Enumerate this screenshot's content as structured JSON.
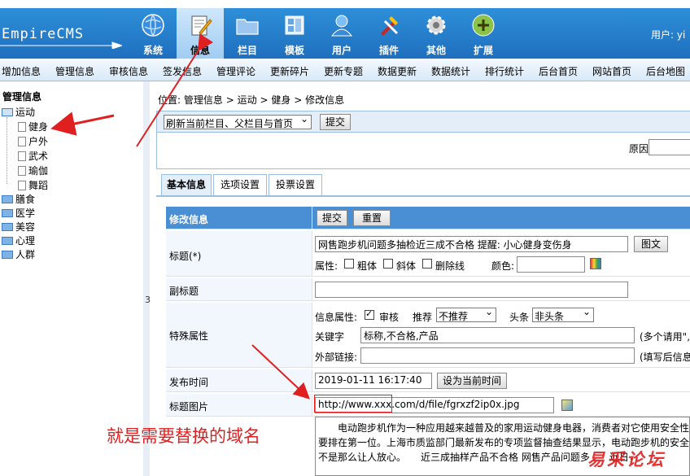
{
  "header": {
    "logo": "EmpireCMS",
    "user_label": "用户: yi",
    "nav": [
      {
        "label": "系统",
        "icon": "globe-icon"
      },
      {
        "label": "信息",
        "icon": "document-pencil-icon",
        "active": true
      },
      {
        "label": "栏目",
        "icon": "folder-icon"
      },
      {
        "label": "模板",
        "icon": "template-icon"
      },
      {
        "label": "用户",
        "icon": "user-icon"
      },
      {
        "label": "插件",
        "icon": "tools-icon"
      },
      {
        "label": "其他",
        "icon": "gear-icon"
      },
      {
        "label": "扩展",
        "icon": "plus-circle-icon"
      }
    ]
  },
  "menubar": [
    "增加信息",
    "管理信息",
    "审核信息",
    "签发信息",
    "管理评论",
    "更新碎片",
    "更新专题",
    "数据更新",
    "数据统计",
    "排行统计",
    "后台首页",
    "网站首页",
    "后台地图"
  ],
  "tree": {
    "title": "管理信息",
    "nodes": [
      {
        "label": "运动",
        "children": [
          "健身",
          "户外",
          "武术",
          "瑜伽",
          "舞蹈"
        ]
      },
      {
        "label": "膳食"
      },
      {
        "label": "医学"
      },
      {
        "label": "美容"
      },
      {
        "label": "心理"
      },
      {
        "label": "人群"
      }
    ],
    "splitter_char": "3"
  },
  "breadcrumb": {
    "prefix": "位置:",
    "items": [
      "管理信息",
      "运动",
      "健身",
      "修改信息"
    ],
    "sep": ">"
  },
  "toolbox": {
    "refresh_select": "刷新当前栏目、父栏目与首页",
    "submit": "提交",
    "reason_label": "原因:"
  },
  "tabs": [
    "基本信息",
    "选项设置",
    "投票设置"
  ],
  "form": {
    "header_label": "修改信息",
    "submit": "提交",
    "reset": "重置",
    "title_label": "标题(*)",
    "title_value": "网售跑步机问题多抽检近三成不合格 提醒: 小心健身变伤身",
    "title_pic_button": "图文",
    "attr_label": "属性:",
    "attrs": [
      "粗体",
      "斜体",
      "删除线"
    ],
    "color_label": "颜色:",
    "subtitle_label": "副标题",
    "special_label": "特殊属性",
    "info_attr_label": "信息属性:",
    "checked_label": "审核",
    "recommend_label": "推荐",
    "recommend_value": "不推荐",
    "headline_label": "头条",
    "headline_value": "非头条",
    "keyword_label": "关键字",
    "keyword_value": "标称,不合格,产品",
    "keyword_hint": "(多个请用\",\"",
    "external_label": "外部链接:",
    "external_hint": "(填写后信息",
    "time_label": "发布时间",
    "time_value": "2019-01-11 16:17:40",
    "time_button": "设为当前时间",
    "titlepic_label": "标题图片",
    "titlepic_value": "http://www.xxx.com/d/file/fgrxzf2ip0x.jpg",
    "desc_lines": [
      "　　电动跑步机作为一种应用越来越普及的家用运动健身电器，消费者对它使用安全性的",
      "要排在第一位。上海市质监部门最新发布的专项监督抽查结果显示，电动跑步机的安全",
      "不是那么让人放心。　　近三成抽样产品不合格 网售产品问题多　　近日，"
    ]
  },
  "annotations": {
    "note": "就是需要替换的域名",
    "watermark": "易采论坛"
  },
  "colors": {
    "header_blue": "#2e8fd8",
    "annotation_red": "#e02020",
    "form_header_blue": "#4a8fd4"
  }
}
